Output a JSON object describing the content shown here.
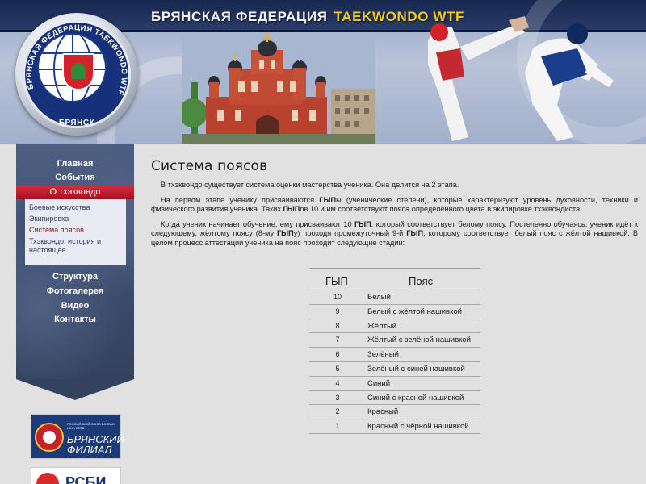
{
  "header": {
    "title_main": "БРЯНСКАЯ ФЕДЕРАЦИЯ",
    "title_accent": "TAEKWONDO WTF",
    "logo_arc_text": "БРЯНСКАЯ ФЕДЕРАЦИЯ ТАЕКWONDO WTF",
    "logo_city": "БРЯНСК"
  },
  "sidebar": {
    "items": [
      {
        "label": "Главная"
      },
      {
        "label": "События"
      },
      {
        "label": "О тхэквондо",
        "active": true
      }
    ],
    "subitems": [
      {
        "label": "Боевые искусства"
      },
      {
        "label": "Экипировка"
      },
      {
        "label": "Система поясов",
        "current": true
      },
      {
        "label": "Тхэквондо: история и настоящее"
      }
    ],
    "items_after": [
      {
        "label": "Структура"
      },
      {
        "label": "Фотогалерея"
      },
      {
        "label": "Видео"
      },
      {
        "label": "Контакты"
      }
    ]
  },
  "banners": {
    "banner1_small": "РОССИЙСКИЙ СОЮЗ БОЕВЫХ ИСКУССТВ",
    "banner1_big": "БРЯНСКИЙ ФИЛИАЛ",
    "banner2_text": "РСБИ"
  },
  "content": {
    "title": "Система поясов",
    "p1": "В тхэквондо существует система оценки мастерства ученика. Она делится на 2 этапа.",
    "p2_a": "На первом этапе ученику присваиваются ",
    "p2_b": "ГЫП",
    "p2_c": "ы (ученические степени), которые характеризуют уровень духовности, техники и физического развития ученика. Таких ",
    "p2_d": "ГЫП",
    "p2_e": "ов 10 и им соответствуют пояса определённого цвета в экипировке тхэквондиста.",
    "p3_a": "Когда ученик начинает обучение, ему присваивают 10 ",
    "p3_b": "ГЫП",
    "p3_c": ", который соответствует белому поясу. Постепенно обучаясь, ученик идёт к следующему, жёлтому поясу (8-му ",
    "p3_d": "ГЫП",
    "p3_e": "у) проходя промежуточный 9-й ",
    "p3_f": "ГЫП",
    "p3_g": ", которому соответствует белый пояс с жёлтой нашивкой. В целом процесс аттестации ученика на пояс проходит следующие стадии:"
  },
  "belt_table": {
    "headers": {
      "gyp": "ГЫП",
      "belt": "Пояс"
    },
    "rows": [
      {
        "gyp": "10",
        "belt": "Белый"
      },
      {
        "gyp": "9",
        "belt": "Белый с жёлтой нашивкой"
      },
      {
        "gyp": "8",
        "belt": "Жёлтый"
      },
      {
        "gyp": "7",
        "belt": "Жёлтый с зелёной нашивкой"
      },
      {
        "gyp": "6",
        "belt": "Зелёный"
      },
      {
        "gyp": "5",
        "belt": "Зелёный с синей нашивкой"
      },
      {
        "gyp": "4",
        "belt": "Синий"
      },
      {
        "gyp": "3",
        "belt": "Синий с красной нашивкой"
      },
      {
        "gyp": "2",
        "belt": "Красный"
      },
      {
        "gyp": "1",
        "belt": "Красный с чёрной нашивкой"
      }
    ]
  },
  "colors": {
    "accent_yellow": "#f3cb25",
    "active_red": "#c61f2f",
    "sidebar_blue": "#3f4e70"
  }
}
